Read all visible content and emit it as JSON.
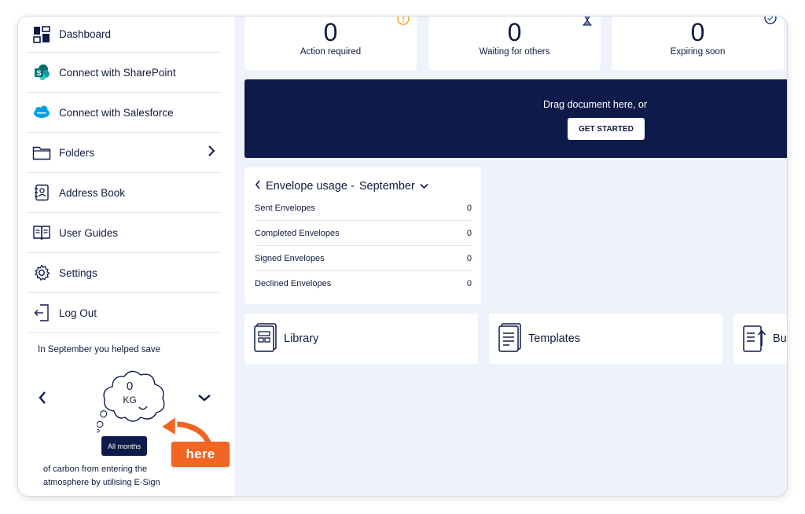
{
  "sidebar": {
    "items": [
      {
        "label": "Dashboard",
        "icon": "dashboard-icon"
      },
      {
        "label": "Connect with SharePoint",
        "icon": "sharepoint-icon"
      },
      {
        "label": "Connect with Salesforce",
        "icon": "salesforce-icon"
      },
      {
        "label": "Folders",
        "icon": "folder-icon"
      },
      {
        "label": "Address Book",
        "icon": "address-book-icon"
      },
      {
        "label": "User Guides",
        "icon": "book-icon"
      },
      {
        "label": "Settings",
        "icon": "gear-icon"
      },
      {
        "label": "Log Out",
        "icon": "logout-icon"
      }
    ],
    "carbon": {
      "intro": "In September you helped save",
      "value": "0",
      "unit": "KG",
      "filter_button": "All months",
      "footer": "of carbon from entering the atmosphere by utilising E-Sign"
    }
  },
  "annotation": {
    "label": "here",
    "color": "#f26522"
  },
  "stats": [
    {
      "value": "0",
      "label": "Action required"
    },
    {
      "value": "0",
      "label": "Waiting for others"
    },
    {
      "value": "0",
      "label": "Expiring soon"
    }
  ],
  "dropzone": {
    "text": "Drag document here, or",
    "button": "GET STARTED"
  },
  "usage": {
    "title": "Envelope usage -",
    "month": "September",
    "rows": [
      {
        "label": "Sent Envelopes",
        "value": "0"
      },
      {
        "label": "Completed Envelopes",
        "value": "0"
      },
      {
        "label": "Signed Envelopes",
        "value": "0"
      },
      {
        "label": "Declined Envelopes",
        "value": "0"
      }
    ]
  },
  "tiles": [
    {
      "label": "Library",
      "icon": "library-icon"
    },
    {
      "label": "Templates",
      "icon": "templates-icon"
    },
    {
      "label": "Bu",
      "icon": "bulk-send-icon"
    }
  ],
  "colors": {
    "navy": "#0e1a4a",
    "accent": "#f26522",
    "background": "#eef2fa"
  }
}
